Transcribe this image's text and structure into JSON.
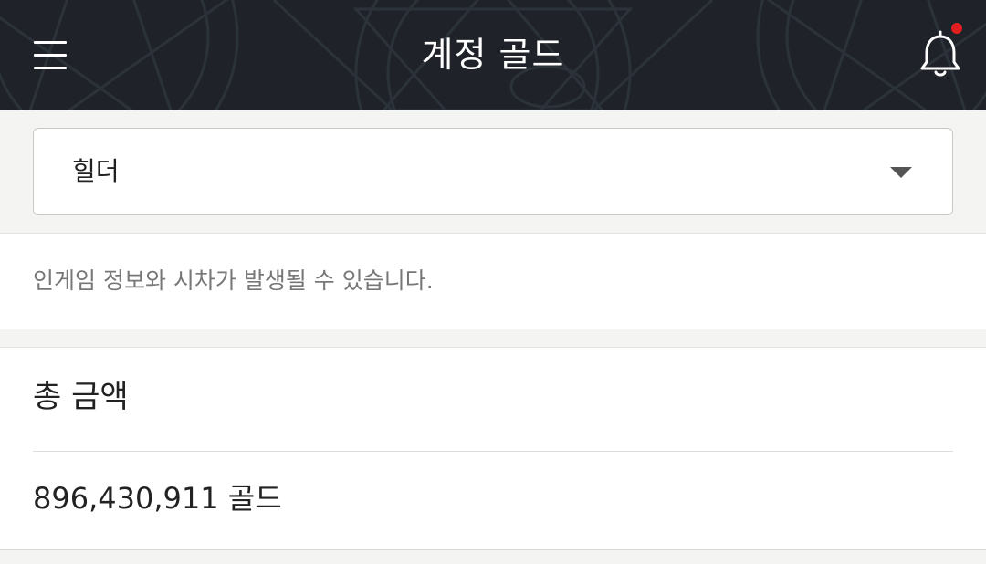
{
  "header": {
    "title": "계정 골드",
    "menu_icon": "hamburger-menu-icon",
    "notification_icon": "bell-icon",
    "notification_dot_color": "#e02020",
    "background_color": "#1f2329"
  },
  "character_select": {
    "selected_value": "힐더",
    "caret_icon": "caret-down-icon"
  },
  "notice": {
    "text": "인게임 정보와 시차가 발생될 수 있습니다."
  },
  "total": {
    "title": "총 금액",
    "amount": "896,430,911 골드"
  }
}
